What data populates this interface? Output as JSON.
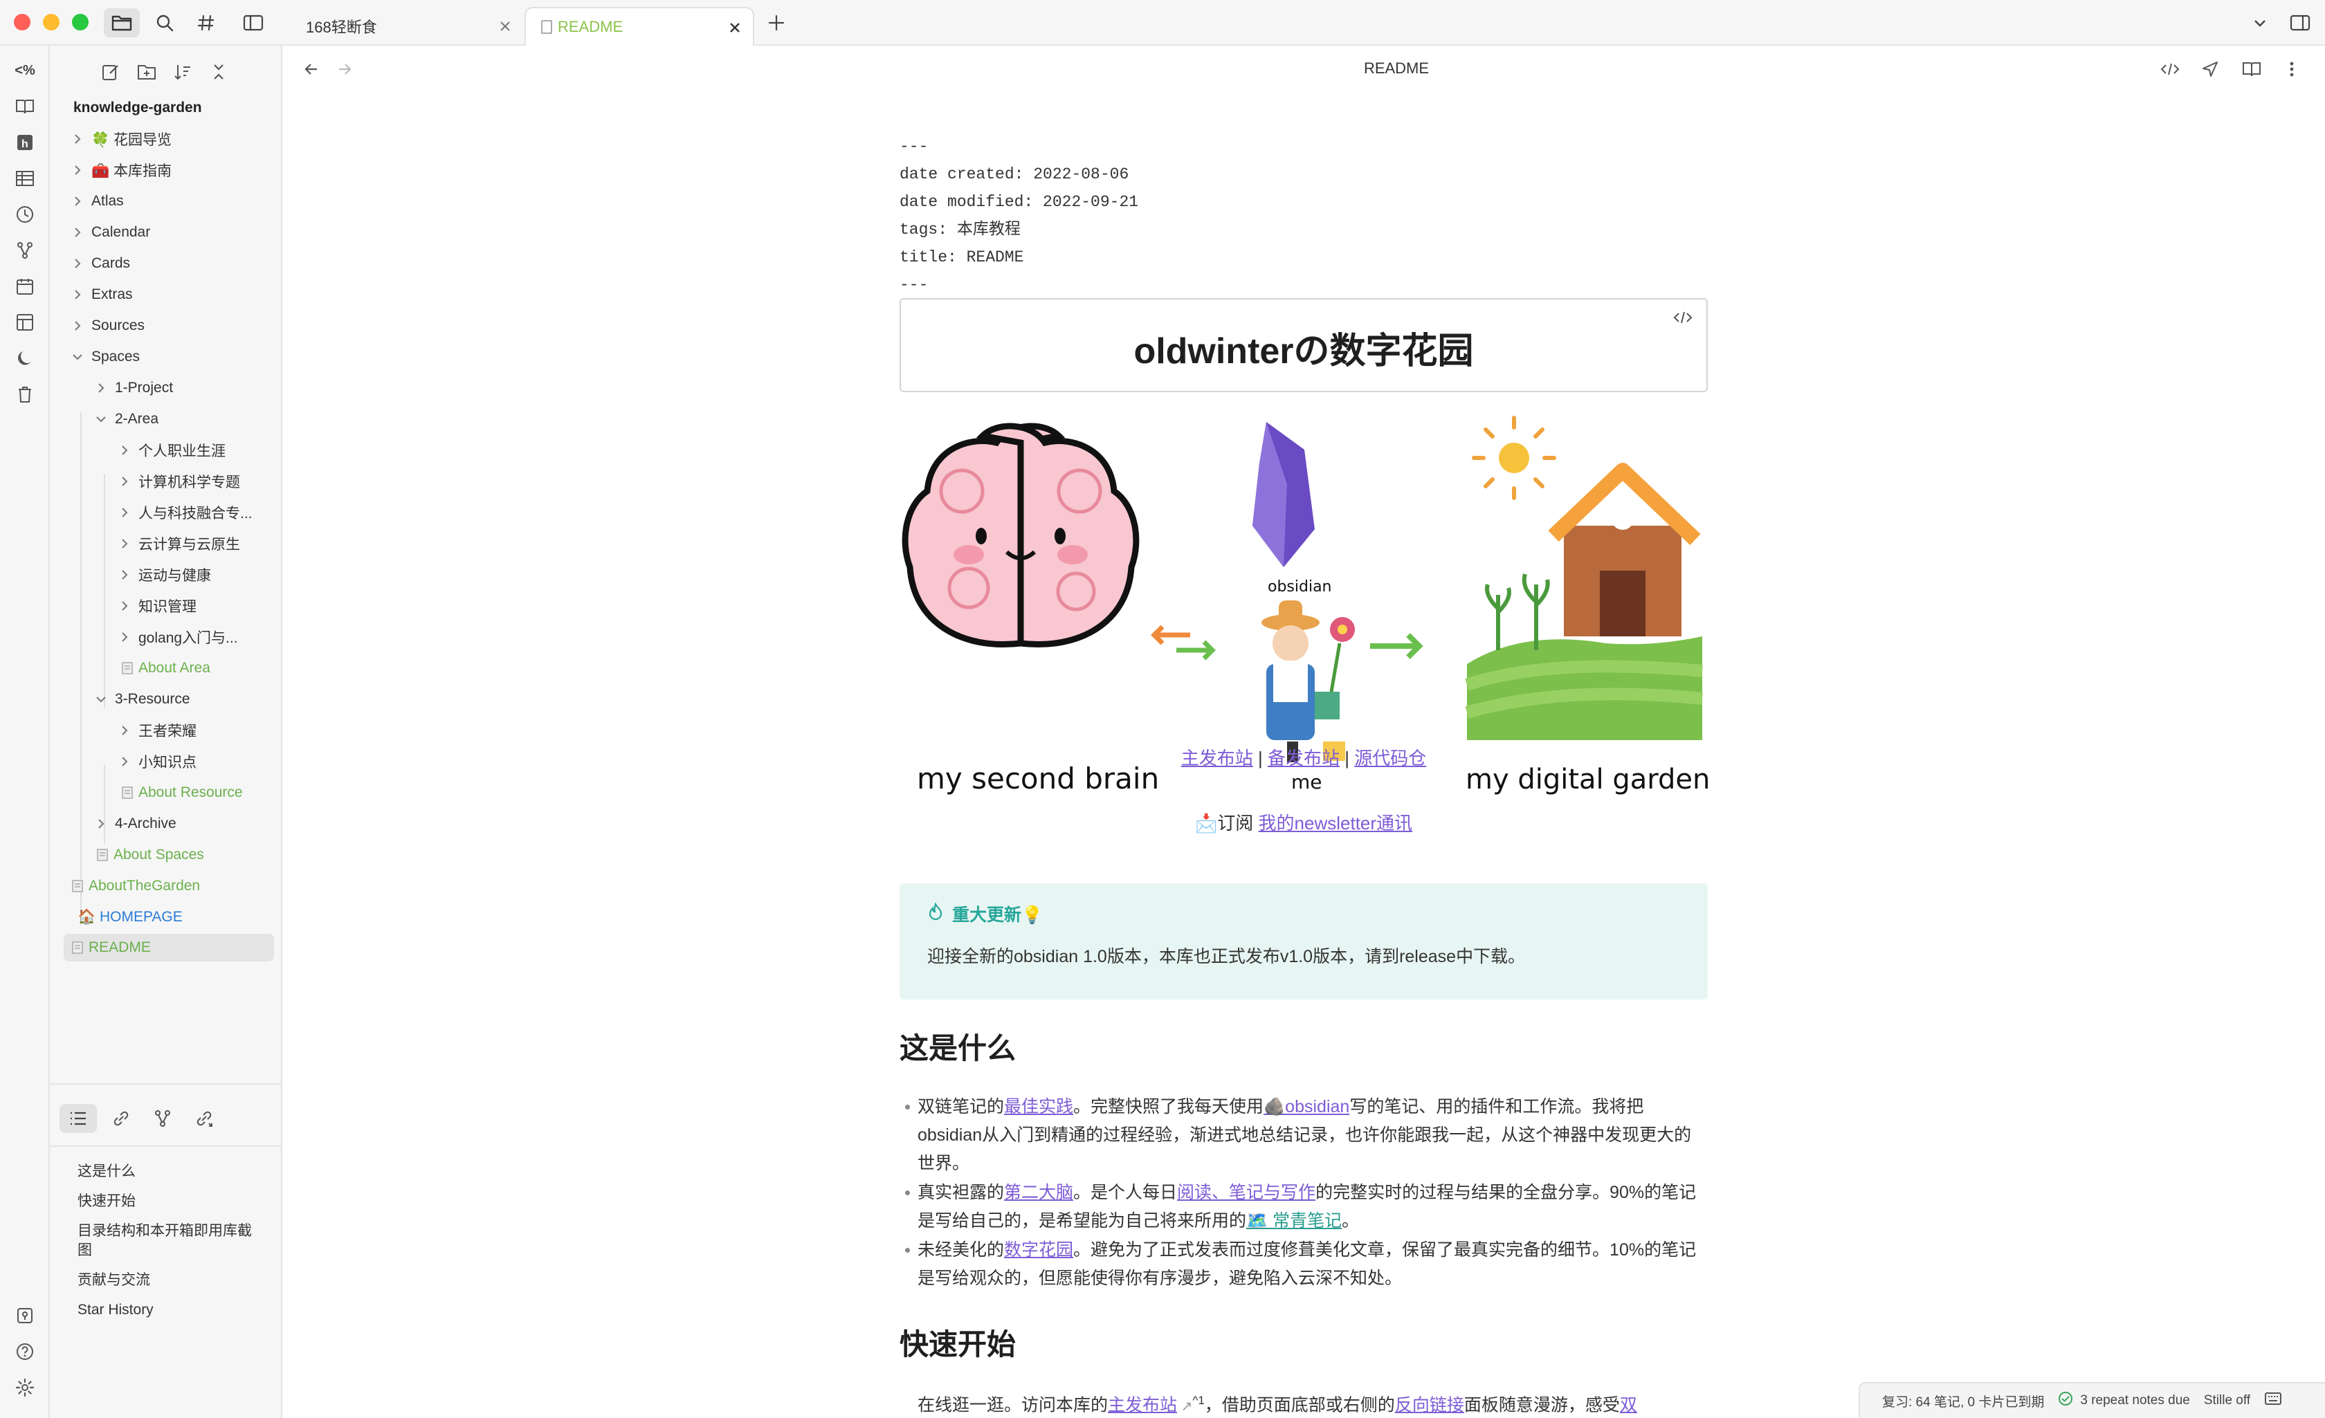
{
  "tabs": [
    {
      "label": "168轻断食",
      "active": false
    },
    {
      "label": "README",
      "active": true
    }
  ],
  "sidebar": {
    "vault_name": "knowledge-garden",
    "tree": [
      {
        "label": "🍀 花园导览"
      },
      {
        "label": "🧰 本库指南"
      },
      {
        "label": "Atlas"
      },
      {
        "label": "Calendar"
      },
      {
        "label": "Cards"
      },
      {
        "label": "Extras"
      },
      {
        "label": "Sources"
      },
      {
        "label": "Spaces"
      },
      {
        "label": "1-Project"
      },
      {
        "label": "2-Area"
      },
      {
        "label": "个人职业生涯"
      },
      {
        "label": "计算机科学专题"
      },
      {
        "label": "人与科技融合专..."
      },
      {
        "label": "云计算与云原生"
      },
      {
        "label": "运动与健康"
      },
      {
        "label": "知识管理"
      },
      {
        "label": "golang入门与..."
      },
      {
        "label": "About Area"
      },
      {
        "label": "3-Resource"
      },
      {
        "label": "王者荣耀"
      },
      {
        "label": "小知识点"
      },
      {
        "label": "About Resource"
      },
      {
        "label": "4-Archive"
      },
      {
        "label": "About Spaces"
      },
      {
        "label": "AboutTheGarden"
      },
      {
        "label": "🏠 HOMEPAGE"
      },
      {
        "label": "README"
      }
    ],
    "outline": [
      {
        "label": "这是什么"
      },
      {
        "label": "快速开始"
      },
      {
        "label": "目录结构和本开箱即用库截图"
      },
      {
        "label": "贡献与交流"
      },
      {
        "label": "Star History"
      }
    ]
  },
  "header": {
    "title": "README"
  },
  "note": {
    "frontmatter": {
      "dash_top": "---",
      "date_created": "date created: 2022-08-06",
      "date_modified": "date modified: 2022-09-21",
      "tags": "tags: 本库教程",
      "title": "title: README",
      "dash_bottom": "---"
    },
    "h1": "oldwinterの数字花园",
    "banner": {
      "brain_caption": "my second brain",
      "obsidian_caption": "obsidian",
      "me_caption": "me",
      "garden_caption": "my digital garden"
    },
    "links": {
      "main_site": "主发布站",
      "backup_site": "备发布站",
      "repo": "源代码仓",
      "sep": "|"
    },
    "newsletter": {
      "prefix": "📩订阅 ",
      "link": "我的newsletter通讯"
    },
    "callout": {
      "title": "重大更新💡",
      "body": "迎接全新的obsidian 1.0版本，本库也正式发布v1.0版本，请到release中下载。"
    },
    "section1": {
      "heading": "这是什么",
      "b1": {
        "t1": "双链笔记的",
        "l1": "最佳实践",
        "t2": "。完整快照了我每天使用",
        "l2": "🪨obsidian",
        "t3": "写的笔记、用的插件和工作流。我将把obsidian从入门到精通的过程经验，渐进式地总结记录，也许你能跟我一起，从这个神器中发现更大的世界。"
      },
      "b2": {
        "t1": "真实袒露的",
        "l1": "第二大脑",
        "t2": "。是个人每日",
        "l2": "阅读、笔记与写作",
        "t3": "的完整实时的过程与结果的全盘分享。90%的笔记是写给自己的，是希望能为自己将来所用的",
        "l3": "🗺️ 常青笔记",
        "t4": "。"
      },
      "b3": {
        "t1": "未经美化的",
        "l1": "数字花园",
        "t2": "。避免为了正式发表而过度修葺美化文章，保留了最真实完备的细节。10%的笔记是写给观众的，但愿能使得你有序漫步，避免陷入云深不知处。"
      }
    },
    "section2": {
      "heading": "快速开始",
      "b1": {
        "t1": "在线逛一逛。访问本库的",
        "l1": "主发布站",
        "sup": "^1",
        "t2": "，借助页面底部或右侧的",
        "l2": "反向链接",
        "t3": "面板随意漫游，感受",
        "l3": "双"
      }
    }
  },
  "statusbar": {
    "review": "复习: 64 笔记, 0 卡片已到期",
    "repeat": "3 repeat notes due",
    "stille": "Stille off"
  },
  "colors": {
    "accent": "#7c5cd6",
    "green_file": "#6ab04c",
    "callout_bg": "#e7f6f3",
    "callout_title": "#26a69a"
  }
}
